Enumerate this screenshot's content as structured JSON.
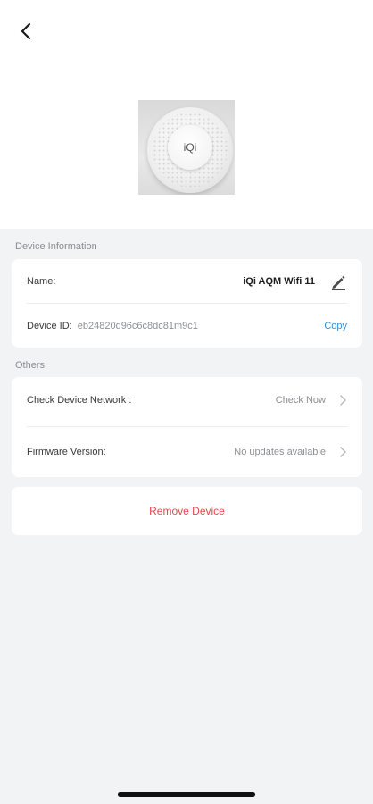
{
  "header": {
    "back_icon": "chevron-left-icon"
  },
  "device": {
    "image_label": "iQi"
  },
  "device_information": {
    "section_title": "Device Information",
    "name_label": "Name:",
    "name_value": "iQi AQM Wifi 11",
    "edit_icon": "pencil-icon",
    "device_id_label": "Device ID:",
    "device_id_value": "eb24820d96c6c8dc81m9c1",
    "copy_label": "Copy"
  },
  "others": {
    "section_title": "Others",
    "network_label": "Check Device Network :",
    "network_action": "Check Now",
    "firmware_label": "Firmware Version:",
    "firmware_value": "No updates available"
  },
  "actions": {
    "remove_label": "Remove Device"
  },
  "colors": {
    "accent_blue": "#2f8fd8",
    "danger_red": "#e5484d",
    "background": "#f1f3f5"
  }
}
